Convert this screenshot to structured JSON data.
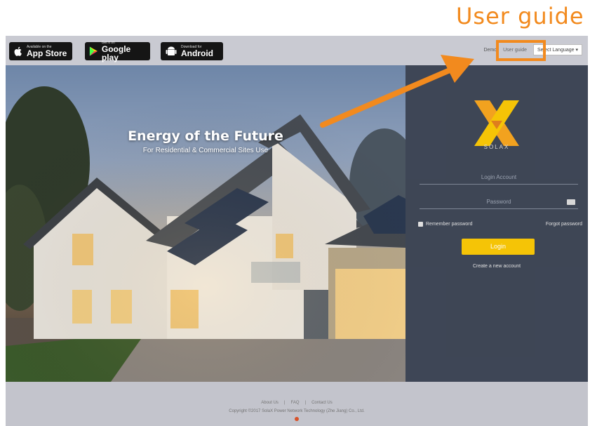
{
  "annotation": {
    "title": "User guide",
    "accent_color": "#f28a1e"
  },
  "topbar": {
    "app_store": {
      "small": "Available on the",
      "big": "App Store"
    },
    "google_play": {
      "small": "Get it on",
      "big": "Google play"
    },
    "android": {
      "small": "Download for",
      "big": "Android"
    },
    "demo_label": "Demo",
    "user_guide_label": "User guide",
    "language_select": "Select Language ▾"
  },
  "hero": {
    "title": "Energy of the Future",
    "subtitle": "For Residential & Commercial Sites Use"
  },
  "login": {
    "logo_text": "SOLAX",
    "account_placeholder": "Login Account",
    "password_placeholder": "Password",
    "remember_label": "Remember password",
    "forgot_label": "Forgot password",
    "login_button": "Login",
    "create_account": "Create a new account",
    "button_color": "#f7c400"
  },
  "footer": {
    "links": [
      "About Us",
      "|",
      "FAQ",
      "|",
      "Contact Us"
    ],
    "copyright": "Copyright ©2017 SolaX Power Network Technology (Zhe Jiang) Co., Ltd."
  }
}
